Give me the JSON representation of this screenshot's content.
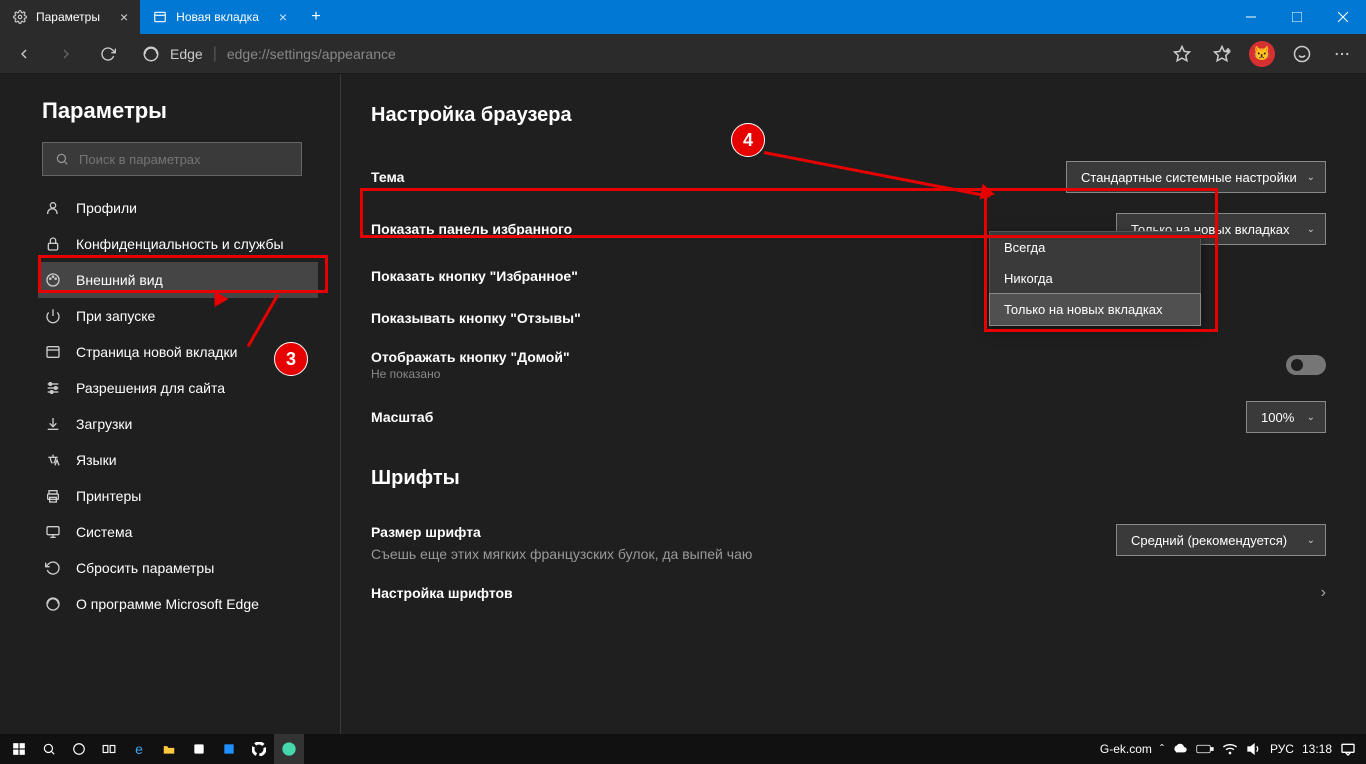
{
  "titlebar": {
    "tabs": [
      {
        "label": "Параметры",
        "active": true
      },
      {
        "label": "Новая вкладка",
        "active": false
      }
    ]
  },
  "addressbar": {
    "brand": "Edge",
    "url": "edge://settings/appearance"
  },
  "sidebar": {
    "title": "Параметры",
    "search_placeholder": "Поиск в параметрах",
    "items": [
      {
        "label": "Профили"
      },
      {
        "label": "Конфиденциальность и службы"
      },
      {
        "label": "Внешний вид",
        "active": true
      },
      {
        "label": "При запуске"
      },
      {
        "label": "Страница новой вкладки"
      },
      {
        "label": "Разрешения для сайта"
      },
      {
        "label": "Загрузки"
      },
      {
        "label": "Языки"
      },
      {
        "label": "Принтеры"
      },
      {
        "label": "Система"
      },
      {
        "label": "Сбросить параметры"
      },
      {
        "label": "О программе Microsoft Edge"
      }
    ]
  },
  "content": {
    "section1_title": "Настройка браузера",
    "theme_label": "Тема",
    "theme_value": "Стандартные системные настройки",
    "fav_panel_label": "Показать панель избранного",
    "fav_panel_value": "Только на новых вкладках",
    "fav_panel_options": [
      "Всегда",
      "Никогда",
      "Только на новых вкладках"
    ],
    "fav_button_label": "Показать кнопку \"Избранное\"",
    "feedback_button_label": "Показывать кнопку \"Отзывы\"",
    "home_button_label": "Отображать кнопку \"Домой\"",
    "home_button_sub": "Не показано",
    "zoom_label": "Масштаб",
    "zoom_value": "100%",
    "section2_title": "Шрифты",
    "font_size_label": "Размер шрифта",
    "font_size_value": "Средний (рекомендуется)",
    "font_sample": "Съешь еще этих мягких французских булок, да выпей чаю",
    "font_custom_label": "Настройка шрифтов"
  },
  "annotations": {
    "badge3": "3",
    "badge4": "4"
  },
  "taskbar": {
    "site": "G-ek.com",
    "lang": "РУС",
    "time": "13:18"
  }
}
